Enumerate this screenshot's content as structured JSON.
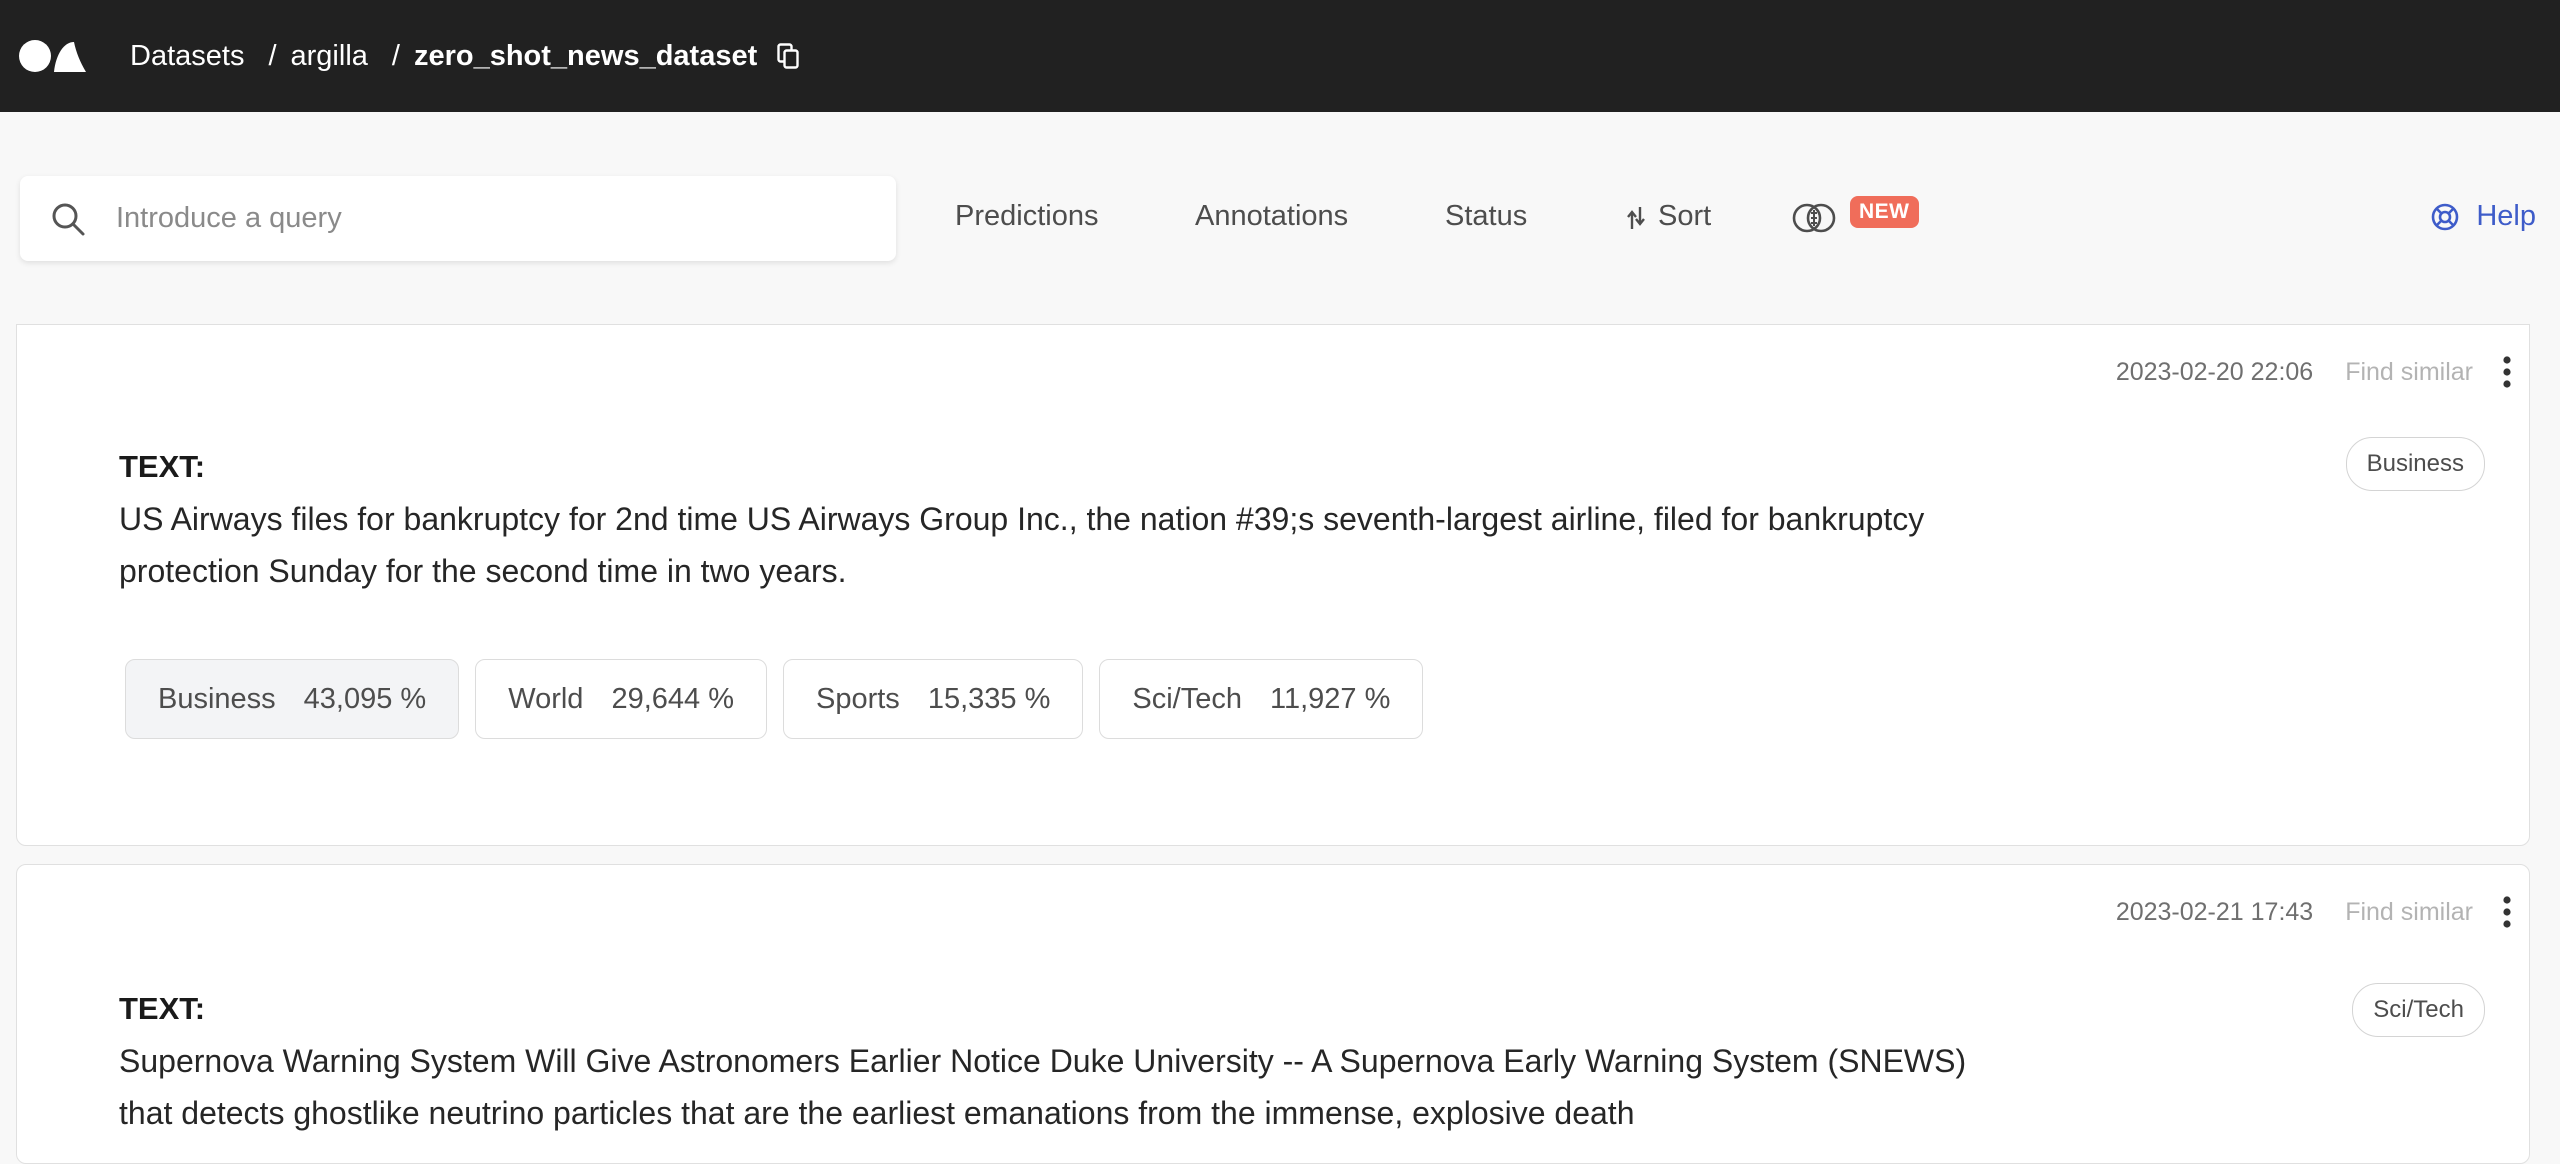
{
  "breadcrumb": {
    "datasets": "Datasets",
    "workspace": "argilla",
    "dataset": "zero_shot_news_dataset",
    "separator": "/"
  },
  "search": {
    "placeholder": "Introduce a query"
  },
  "filters": {
    "predictions": "Predictions",
    "annotations": "Annotations",
    "status": "Status",
    "sort": "Sort",
    "new_badge": "NEW"
  },
  "help": "Help",
  "records": [
    {
      "date": "2023-02-20 22:06",
      "find_similar": "Find similar",
      "tag": "Business",
      "field_title": "TEXT:",
      "text": "US Airways files for bankruptcy for 2nd time US Airways Group Inc., the nation #39;s seventh-largest airline, filed for bankruptcy protection Sunday for the second time in two years.",
      "predictions": [
        {
          "label": "Business",
          "score": "43,095 %"
        },
        {
          "label": "World",
          "score": "29,644 %"
        },
        {
          "label": "Sports",
          "score": "15,335 %"
        },
        {
          "label": "Sci/Tech",
          "score": "11,927 %"
        }
      ]
    },
    {
      "date": "2023-02-21 17:43",
      "find_similar": "Find similar",
      "tag": "Sci/Tech",
      "field_title": "TEXT:",
      "text": "Supernova Warning System Will Give Astronomers Earlier Notice Duke University -- A Supernova Early Warning System (SNEWS) that detects ghostlike neutrino particles that are the earliest emanations from the immense, explosive death"
    }
  ],
  "colors": {
    "topbar": "#212121",
    "accent": "#3e5cc9",
    "new_badge": "#f06d5a"
  }
}
